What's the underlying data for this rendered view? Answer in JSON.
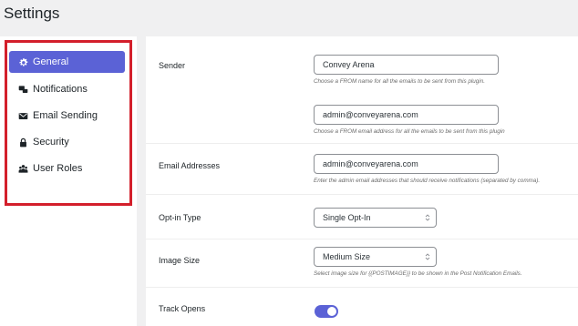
{
  "page": {
    "title": "Settings"
  },
  "sidebar": {
    "items": [
      {
        "label": "General",
        "icon": "gear-icon",
        "active": true
      },
      {
        "label": "Notifications",
        "icon": "notifications-icon",
        "active": false
      },
      {
        "label": "Email Sending",
        "icon": "envelope-icon",
        "active": false
      },
      {
        "label": "Security",
        "icon": "lock-icon",
        "active": false
      },
      {
        "label": "User Roles",
        "icon": "users-icon",
        "active": false
      }
    ]
  },
  "settings": {
    "sender": {
      "label": "Sender",
      "from_name": "Convey Arena",
      "from_name_hint": "Choose a FROM name for all the emails to be sent from this plugin.",
      "from_email": "admin@conveyarena.com",
      "from_email_hint": "Choose a FROM email address for all the emails to be sent from this plugin"
    },
    "email_addresses": {
      "label": "Email Addresses",
      "value": "admin@conveyarena.com",
      "hint": "Enter the admin email addresses that should receive notifications (separated by comma)."
    },
    "opt_in_type": {
      "label": "Opt-in Type",
      "value": "Single Opt-In"
    },
    "image_size": {
      "label": "Image Size",
      "value": "Medium Size",
      "hint": "Select image size for {{POSTIMAGE}} to be shown in the Post Notification Emails."
    },
    "track_opens": {
      "label": "Track Opens",
      "enabled": true
    }
  },
  "colors": {
    "accent": "#5b62d6",
    "highlight_border": "#d31f2b"
  }
}
